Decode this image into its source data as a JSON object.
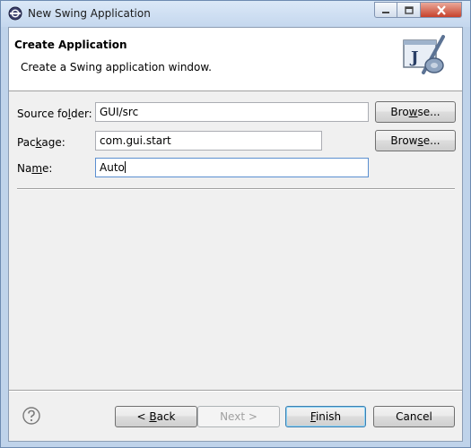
{
  "window": {
    "title": "New Swing Application",
    "icon": "eclipse-icon",
    "controls": {
      "minimize": "minimize",
      "maximize": "maximize",
      "close": "close"
    }
  },
  "header": {
    "title": "Create Application",
    "description": "Create a Swing application window.",
    "icon": "java-swing-wizard-icon"
  },
  "form": {
    "source_folder": {
      "label_pre": "Source fo",
      "label_mn": "l",
      "label_post": "der:",
      "value": "GUI/src",
      "browse_pre": "Bro",
      "browse_mn": "w",
      "browse_post": "se..."
    },
    "package": {
      "label_pre": "Pac",
      "label_mn": "k",
      "label_post": "age:",
      "value": "com.gui.start",
      "browse_pre": "Brow",
      "browse_mn": "s",
      "browse_post": "e..."
    },
    "name": {
      "label_pre": "Na",
      "label_mn": "m",
      "label_post": "e:",
      "value": "Auto"
    }
  },
  "buttons": {
    "help_icon": "help-icon",
    "back_pre": "< ",
    "back_mn": "B",
    "back_post": "ack",
    "next": "Next >",
    "finish_mn": "F",
    "finish_post": "inish",
    "cancel": "Cancel"
  },
  "colors": {
    "title_bar": "#c4d7ee",
    "dialog_bg": "#f0f0f0",
    "close_button": "#c7412b",
    "focus_border": "#5b8fd0"
  }
}
